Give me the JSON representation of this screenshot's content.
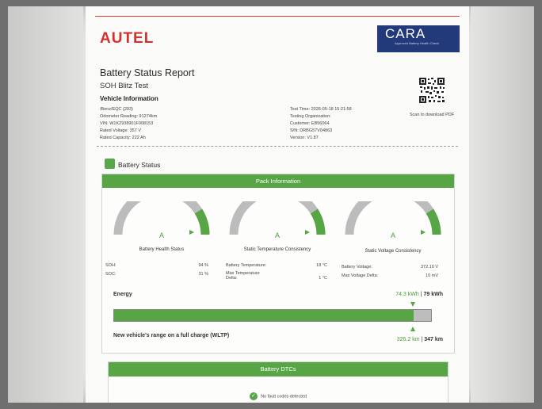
{
  "brand": {
    "logo": "AUTEL",
    "cert_name": "CARA",
    "cert_sub": "Approved Battery Health Check"
  },
  "report": {
    "title": "Battery Status Report",
    "subtitle": "SOH Blitz Test",
    "vehicle_heading": "Vehicle Information",
    "vehicle_lines": [
      "/Benz/EQC (293)",
      "Odometer Reading: 91274km",
      "VIN: W1K2938901F008153",
      "Rated Voltage: 357 V",
      "Rated Capacity: 222 Ah"
    ],
    "test_lines": [
      "Test Time: 2026-05-18 15:21:58",
      "Testing Organization:",
      "Customer: EB56064",
      "S/N: DRBG57V04863",
      "Version: V1.87"
    ],
    "scan_text": "Scan to download PDF"
  },
  "battery_status": {
    "label": "Battery Status",
    "pack_header": "Pack Information",
    "gauges": [
      {
        "title": "Battery Health Status",
        "grade": "A",
        "level": 0.82
      },
      {
        "title": "Static Temperature Consistency",
        "grade": "A",
        "level": 0.82
      },
      {
        "title": "Static Voltage Consistency",
        "grade": "A",
        "level": 0.82
      }
    ],
    "metrics": {
      "soh_label": "SOH:",
      "soh_value": "94 %",
      "soc_label": "SOC:",
      "soc_value": "31 %",
      "temp_label": "Battery Temperature:",
      "temp_value": "18 °C",
      "max_temp_label": "Max Temperature Delta:",
      "max_temp_value": "1 °C",
      "volt_label": "Battery Voltage:",
      "volt_value": "372.10 V",
      "max_volt_label": "Max Voltage Delta:",
      "max_volt_value": "10 mV"
    },
    "energy": {
      "label": "Energy",
      "current": "74.3 kWh",
      "separator": " | ",
      "total": "79 kWh",
      "fraction": 0.94
    },
    "range": {
      "label": "New vehicle's range on a full charge (WLTP)",
      "current": "326.2 km",
      "separator": " | ",
      "total": "347 km"
    }
  },
  "dtc": {
    "header": "Battery DTCs",
    "status": "No fault codes detected"
  },
  "colors": {
    "accent_green": "#57a545",
    "brand_red": "#d2322e",
    "cara_blue": "#233a7a"
  }
}
